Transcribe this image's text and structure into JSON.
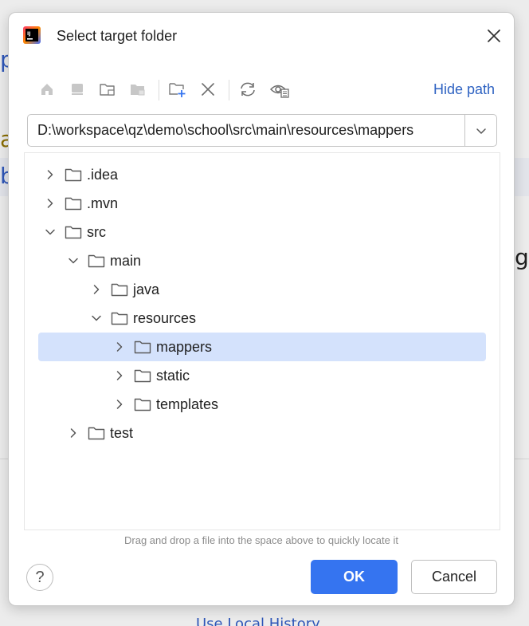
{
  "background": {
    "peek_p": "p",
    "peek_a": "a",
    "peek_b": "b",
    "peek_g": "g",
    "bottom_link": "Use Local History"
  },
  "dialog": {
    "title": "Select target folder",
    "app_icon": "intellij-idea-icon",
    "close_icon": "close-icon"
  },
  "toolbar": {
    "icons": [
      "home-icon",
      "desktop-icon",
      "project-folder-icon",
      "module-folder-icon",
      "new-folder-icon",
      "delete-icon",
      "refresh-icon",
      "show-hidden-icon"
    ],
    "hide_path_label": "Hide path"
  },
  "path": {
    "value": "D:\\workspace\\qz\\demo\\school\\src\\main\\resources\\mappers",
    "dropdown_icon": "chevron-down-icon"
  },
  "tree": {
    "items": [
      {
        "label": ".idea",
        "depth": 0,
        "expanded": false
      },
      {
        "label": ".mvn",
        "depth": 0,
        "expanded": false
      },
      {
        "label": "src",
        "depth": 0,
        "expanded": true
      },
      {
        "label": "main",
        "depth": 1,
        "expanded": true
      },
      {
        "label": "java",
        "depth": 2,
        "expanded": false
      },
      {
        "label": "resources",
        "depth": 2,
        "expanded": true
      },
      {
        "label": "mappers",
        "depth": 3,
        "expanded": false,
        "selected": true
      },
      {
        "label": "static",
        "depth": 3,
        "expanded": false
      },
      {
        "label": "templates",
        "depth": 3,
        "expanded": false
      },
      {
        "label": "test",
        "depth": 1,
        "expanded": false
      }
    ]
  },
  "hint": "Drag and drop a file into the space above to quickly locate it",
  "footer": {
    "help_label": "?",
    "ok_label": "OK",
    "cancel_label": "Cancel"
  },
  "colors": {
    "accent": "#3574f0",
    "selection": "#d4e2fc",
    "link": "#2e62c2"
  }
}
